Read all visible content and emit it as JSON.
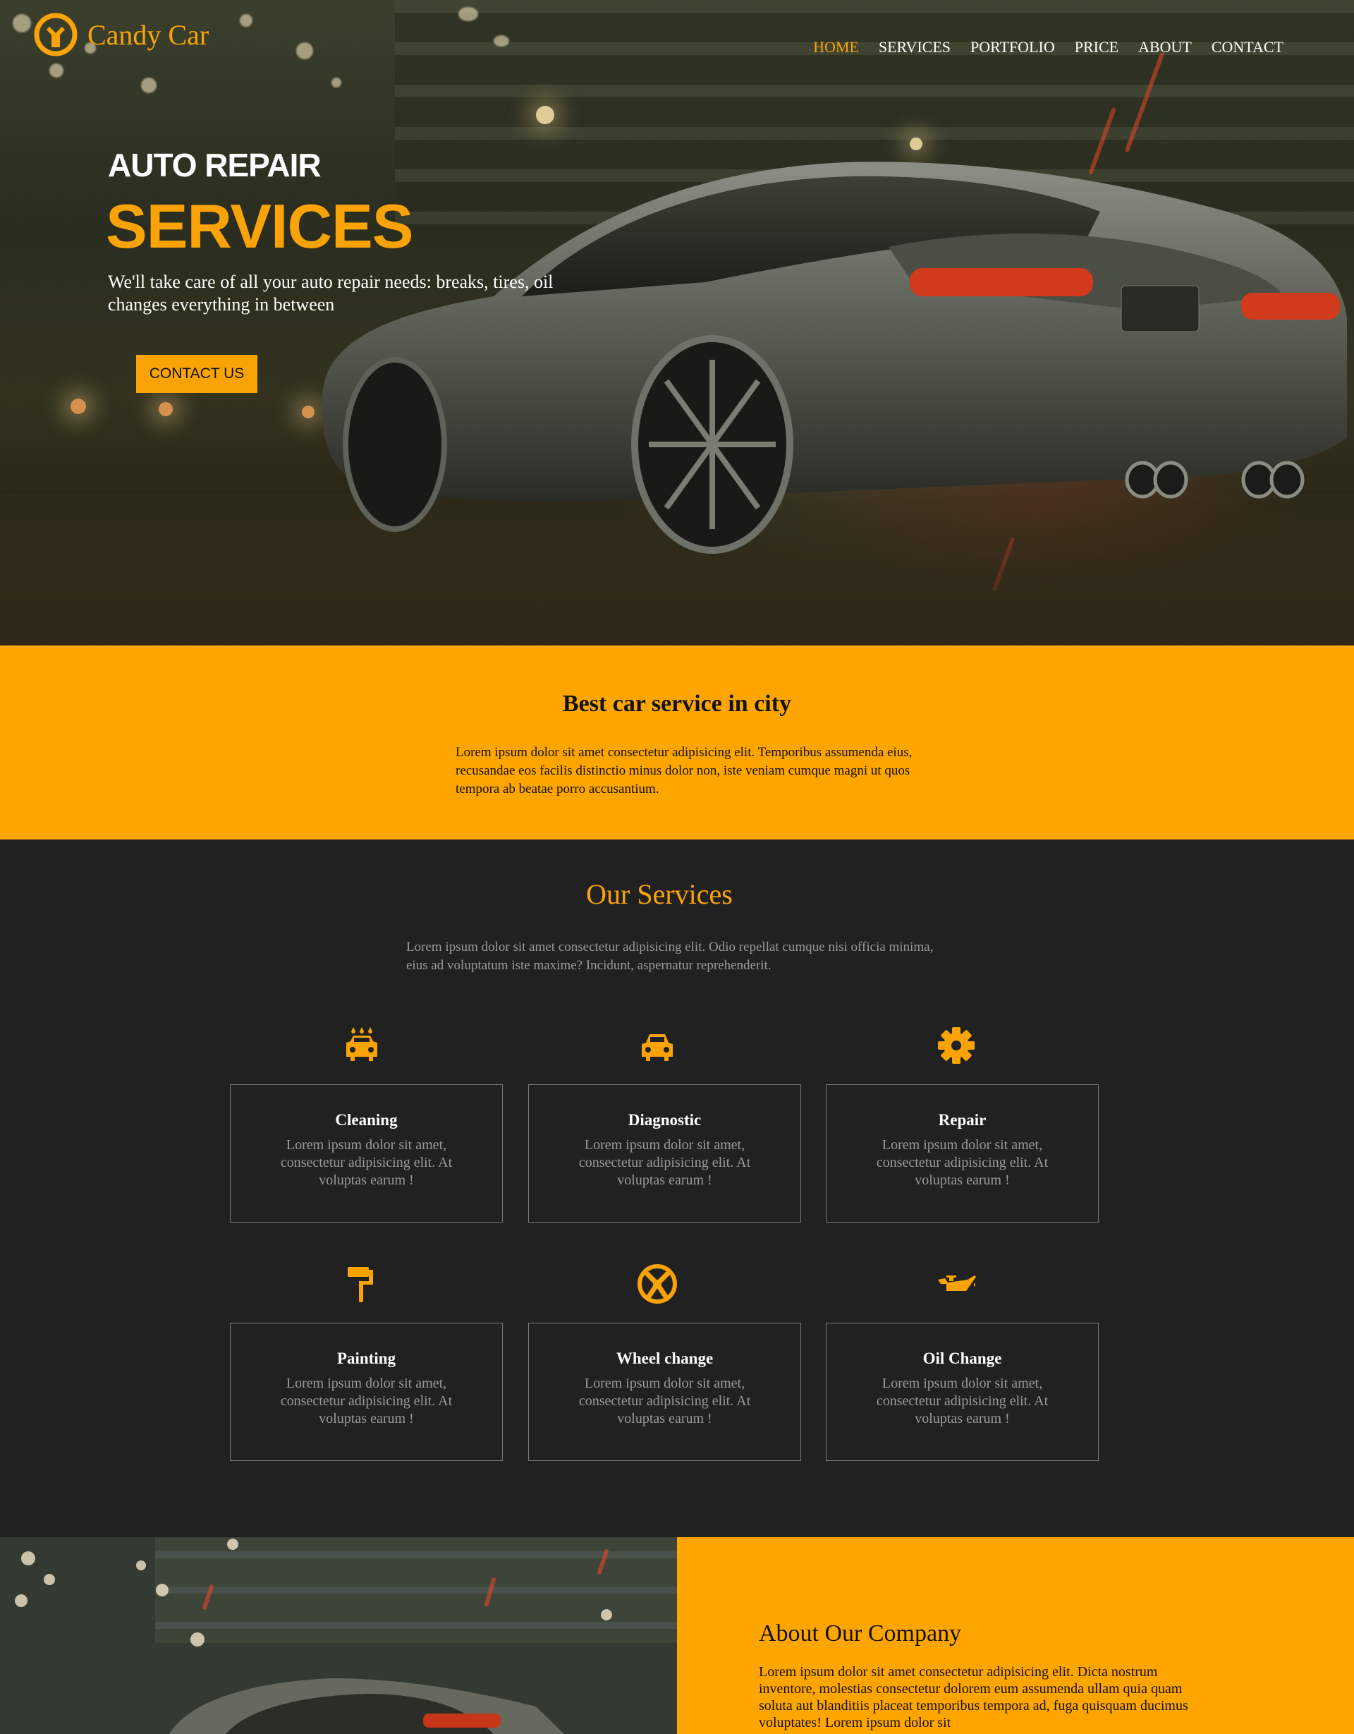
{
  "brand": {
    "name": "Candy Car",
    "logo_icon": "wrench-circle-icon",
    "accent": "#f9a307"
  },
  "nav": {
    "items": [
      "HOME",
      "SERVICES",
      "PORTFOLIO",
      "PRICE",
      "ABOUT",
      "CONTACT"
    ],
    "active": "HOME"
  },
  "hero": {
    "pre_title": "AUTO REPAIR",
    "title": "SERVICES",
    "text": "We'll take care of all your auto repair needs: breaks, tires, oil changes everything in between",
    "button": "CONTACT US"
  },
  "band": {
    "title": "Best car service in city",
    "text": "Lorem ipsum dolor sit amet consectetur adipisicing elit. Temporibus assumenda eius, recusandae eos facilis distinctio minus dolor non, iste veniam cumque magni ut quos tempora ab beatae porro accusantium.",
    "background": "#ffa500"
  },
  "services": {
    "title": "Our Services",
    "intro": "Lorem ipsum dolor sit amet consectetur adipisicing elit. Odio repellat cumque nisi officia minima, eius ad voluptatum iste maxime? Incidunt, aspernatur reprehenderit.",
    "items": [
      {
        "title": "Cleaning",
        "icon": "car-wash-icon",
        "text": "Lorem ipsum dolor sit amet, consectetur adipisicing elit. At voluptas earum !"
      },
      {
        "title": "Diagnostic",
        "icon": "car-icon",
        "text": "Lorem ipsum dolor sit amet, consectetur adipisicing elit. At voluptas earum !"
      },
      {
        "title": "Repair",
        "icon": "gear-icon",
        "text": "Lorem ipsum dolor sit amet, consectetur adipisicing elit. At voluptas earum !"
      },
      {
        "title": "Painting",
        "icon": "paint-roller-icon",
        "text": "Lorem ipsum dolor sit amet, consectetur adipisicing elit. At voluptas earum !"
      },
      {
        "title": "Wheel change",
        "icon": "steering-wheel-icon",
        "text": "Lorem ipsum dolor sit amet, consectetur adipisicing elit. At voluptas earum !"
      },
      {
        "title": "Oil Change",
        "icon": "oil-can-icon",
        "text": "Lorem ipsum dolor sit amet, consectetur adipisicing elit. At voluptas earum !"
      }
    ]
  },
  "about": {
    "title": "About Our Company",
    "text": "Lorem ipsum dolor sit amet consectetur adipisicing elit. Dicta nostrum inventore, molestias consectetur dolorem eum assumenda ullam quia quam soluta aut blanditiis placeat temporibus tempora ad, fuga quisquam ducimus voluptates! Lorem ipsum dolor sit"
  }
}
